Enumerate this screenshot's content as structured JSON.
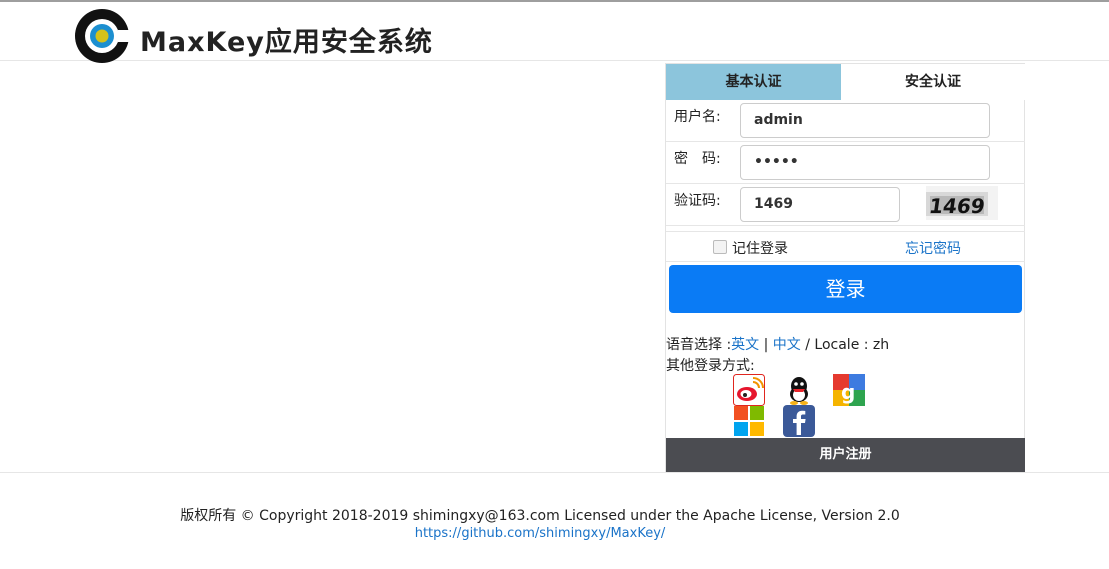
{
  "header": {
    "title": "MaxKey应用安全系统",
    "logo_icon": "maxkey-logo-icon"
  },
  "login": {
    "tabs": [
      {
        "label": "基本认证",
        "active": true
      },
      {
        "label": "安全认证",
        "active": false
      }
    ],
    "username": {
      "label": "用户名:",
      "value": "admin"
    },
    "password": {
      "label": "密　码:",
      "value": "•••••"
    },
    "captcha": {
      "label": "验证码:",
      "value": "1469",
      "image_text": "1469"
    },
    "remember_label": "记住登录",
    "forgot_label": "忘记密码",
    "submit_label": "登录",
    "language": {
      "prefix": "语音选择 :",
      "english": "英文",
      "separator": " | ",
      "chinese": "中文",
      "locale": " / Locale : zh"
    },
    "other_login_label": "其他登录方式:",
    "social_icons": [
      "weibo-icon",
      "qq-icon",
      "google-icon",
      "microsoft-icon",
      "facebook-icon"
    ],
    "register_label": "用户注册"
  },
  "footer": {
    "copyright": "版权所有 © Copyright 2018-2019 shimingxy@163.com Licensed under the Apache License, Version 2.0",
    "link": "https://github.com/shimingxy/MaxKey/"
  },
  "colors": {
    "tab_active": "#8cc5dc",
    "primary_button": "#0a7bf5",
    "link": "#1a73c8",
    "register_bar": "#4b4c51"
  }
}
